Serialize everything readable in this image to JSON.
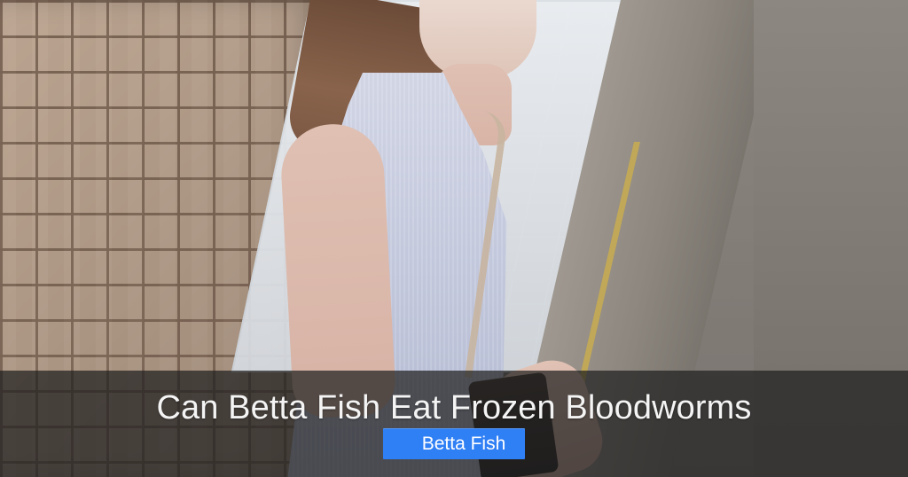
{
  "caption": {
    "title": "Can Betta Fish Eat Frozen Bloodworms",
    "tag_label": "Betta Fish",
    "tag_icon": "",
    "tag_color": "#2f7ff5"
  }
}
